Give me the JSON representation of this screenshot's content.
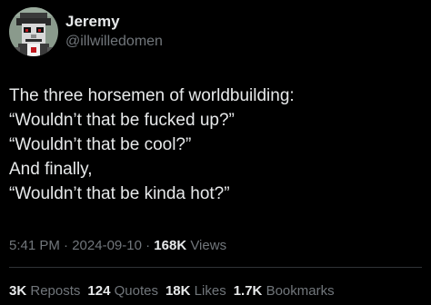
{
  "author": {
    "display_name": "Jeremy",
    "handle": "@illwilledomen",
    "avatar_icon": "pixel-art-avatar-icon"
  },
  "tweet": {
    "lines": [
      "The three horsemen of worldbuilding:",
      "“Wouldn’t that be fucked up?”",
      "“Wouldn’t that be cool?”",
      "And finally,",
      "“Wouldn’t that be kinda hot?”"
    ]
  },
  "meta": {
    "time": "5:41 PM",
    "separator": " · ",
    "date": "2024-09-10",
    "views_count": "168K",
    "views_label": "Views"
  },
  "stats": [
    {
      "count": "3K",
      "label": "Reposts"
    },
    {
      "count": "124",
      "label": "Quotes"
    },
    {
      "count": "18K",
      "label": "Likes"
    },
    {
      "count": "1.7K",
      "label": "Bookmarks"
    }
  ],
  "colors": {
    "background": "#000000",
    "primary_text": "#e7e9ea",
    "secondary_text": "#71767b",
    "divider": "#2f3336"
  }
}
